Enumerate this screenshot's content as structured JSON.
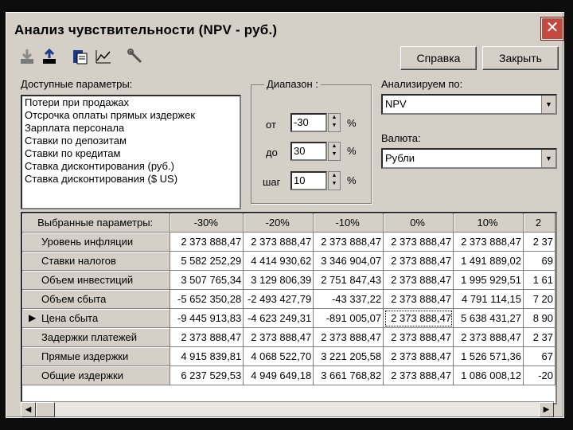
{
  "window": {
    "title": "Анализ чувствительности (NPV - руб.)",
    "close_glyph": "✕"
  },
  "toolbar": {
    "icons": [
      "download-icon",
      "upload-icon",
      "copy-icon",
      "chart-icon",
      "wrench-icon"
    ],
    "help_label": "Справка",
    "close_label": "Закрыть"
  },
  "params": {
    "label": "Доступные параметры:",
    "items": [
      "Потери при продажах",
      "Отсрочка оплаты прямых издержек",
      "Зарплата персонала",
      "Ставки по депозитам",
      "Ставки по кредитам",
      "Ставка дисконтирования (руб.)",
      "Ставка дисконтирования ($ US)"
    ]
  },
  "range": {
    "title": "Диапазон :",
    "from_label": "от",
    "from_value": "-30",
    "to_label": "до",
    "to_value": "30",
    "step_label": "шаг",
    "step_value": "10",
    "unit": "%"
  },
  "analyze": {
    "label": "Анализируем по:",
    "value": "NPV"
  },
  "currency": {
    "label": "Валюта:",
    "value": "Рубли"
  },
  "grid": {
    "corner": "Выбранные параметры:",
    "columns": [
      "-30%",
      "-20%",
      "-10%",
      "0%",
      "10%",
      "2"
    ],
    "rows": [
      {
        "name": "Уровень инфляции",
        "cells": [
          "2 373 888,47",
          "2 373 888,47",
          "2 373 888,47",
          "2 373 888,47",
          "2 373 888,47",
          "2 37"
        ]
      },
      {
        "name": "Ставки налогов",
        "cells": [
          "5 582 252,29",
          "4 414 930,62",
          "3 346 904,07",
          "2 373 888,47",
          "1 491 889,02",
          "69"
        ]
      },
      {
        "name": "Объем инвестиций",
        "cells": [
          "3 507 765,34",
          "3 129 806,39",
          "2 751 847,43",
          "2 373 888,47",
          "1 995 929,51",
          "1 61"
        ]
      },
      {
        "name": "Объем сбыта",
        "cells": [
          "-5 652 350,28",
          "-2 493 427,79",
          "-43 337,22",
          "2 373 888,47",
          "4 791 114,15",
          "7 20"
        ]
      },
      {
        "name": "Цена сбыта",
        "cells": [
          "-9 445 913,83",
          "-4 623 249,31",
          "-891 005,07",
          "2 373 888,47",
          "5 638 431,27",
          "8 90"
        ]
      },
      {
        "name": "Задержки платежей",
        "cells": [
          "2 373 888,47",
          "2 373 888,47",
          "2 373 888,47",
          "2 373 888,47",
          "2 373 888,47",
          "2 37"
        ]
      },
      {
        "name": "Прямые издержки",
        "cells": [
          "4 915 839,81",
          "4 068 522,70",
          "3 221 205,58",
          "2 373 888,47",
          "1 526 571,36",
          "67"
        ]
      },
      {
        "name": "Общие издержки",
        "cells": [
          "6 237 529,53",
          "4 949 649,18",
          "3 661 768,82",
          "2 373 888,47",
          "1 086 008,12",
          "-20"
        ]
      }
    ],
    "pointer_glyph": "▶"
  }
}
